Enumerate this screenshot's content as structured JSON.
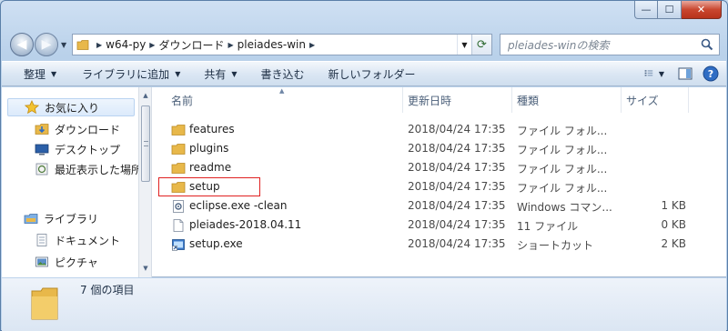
{
  "window": {
    "close_glyph": "✕",
    "minimize_glyph": "—",
    "maximize_glyph": "☐"
  },
  "address": {
    "crumbs": [
      "w64-py",
      "ダウンロード",
      "pleiades-win"
    ]
  },
  "search": {
    "placeholder": "pleiades-winの検索",
    "icon": "magnifier"
  },
  "toolbar": {
    "organize": "整理",
    "add_to_library": "ライブラリに追加",
    "share": "共有",
    "burn": "書き込む",
    "new_folder": "新しいフォルダー"
  },
  "nav": {
    "favorites": "お気に入り",
    "downloads": "ダウンロード",
    "desktop": "デスクトップ",
    "recent": "最近表示した場所",
    "libraries": "ライブラリ",
    "documents": "ドキュメント",
    "pictures": "ピクチャ"
  },
  "columns": {
    "name": "名前",
    "date": "更新日時",
    "type": "種類",
    "size": "サイズ"
  },
  "files": [
    {
      "name": "features",
      "date": "2018/04/24 17:35",
      "type": "ファイル フォル...",
      "size": "",
      "icon": "folder-icon"
    },
    {
      "name": "plugins",
      "date": "2018/04/24 17:35",
      "type": "ファイル フォル...",
      "size": "",
      "icon": "folder-icon"
    },
    {
      "name": "readme",
      "date": "2018/04/24 17:35",
      "type": "ファイル フォル...",
      "size": "",
      "icon": "folder-icon"
    },
    {
      "name": "setup",
      "date": "2018/04/24 17:35",
      "type": "ファイル フォル...",
      "size": "",
      "icon": "folder-icon"
    },
    {
      "name": "eclipse.exe -clean",
      "date": "2018/04/24 17:35",
      "type": "Windows コマン...",
      "size": "1 KB",
      "icon": "batch-file-icon"
    },
    {
      "name": "pleiades-2018.04.11",
      "date": "2018/04/24 17:35",
      "type": "11 ファイル",
      "size": "0 KB",
      "icon": "file-icon"
    },
    {
      "name": "setup.exe",
      "date": "2018/04/24 17:35",
      "type": "ショートカット",
      "size": "2 KB",
      "icon": "shortcut-icon"
    }
  ],
  "details": {
    "count_text": "7 個の項目"
  },
  "colors": {
    "highlight_border": "#e02020",
    "folder": "#e8b84a"
  }
}
